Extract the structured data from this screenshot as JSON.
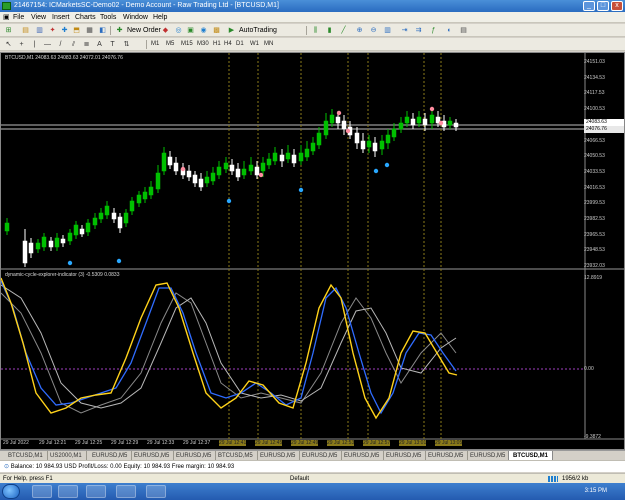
{
  "window": {
    "title": "21467154: ICMarketsSC-Demo02 - Demo Account - Raw Trading Ltd - [BTCUSD,M1]"
  },
  "menu": [
    "File",
    "View",
    "Insert",
    "Charts",
    "Tools",
    "Window",
    "Help"
  ],
  "toolbar": {
    "new_order": "New Order",
    "autotrading": "AutoTrading",
    "timeframes": [
      "M1",
      "M5",
      "M15",
      "M30",
      "H1",
      "H4",
      "D1",
      "W1",
      "MN"
    ]
  },
  "chart": {
    "info_label": "BTCUSD,M1  24083.63 24083.63 24072.01 24076.76",
    "indicator_label": "dynamic-cycle-explorer-indicator (3) -0.5309 0.0833",
    "price_axis": [
      "24151.03",
      "24134.53",
      "24117.53",
      "24100.53",
      "24083.53",
      "24066.53",
      "24050.53",
      "24033.53",
      "24016.53",
      "23999.53",
      "23982.53",
      "23965.53",
      "23948.53",
      "23932.03"
    ],
    "current_price_1": "24083.63",
    "current_price_2": "24076.76",
    "indicator_axis": [
      "12.8919",
      "0.00",
      "-9.3872"
    ],
    "time_axis": [
      "29 Jul 2022",
      "29 Jul 12:21",
      "29 Jul 12:25",
      "29 Jul 12:29",
      "29 Jul 12:33",
      "29 Jul 12:37",
      "29 Jul 12:41",
      "29 Jul 12:45",
      "29 Jul 12:49",
      "29 Jul 12:53",
      "29 Jul 12:57",
      "29 Jul 13:01",
      "29 Jul 13:05"
    ],
    "colors": {
      "background": "#000000",
      "bull": "#00c000",
      "bear": "#ffffff",
      "signal_up": "#29a8ff",
      "signal_down": "#ff8ca0",
      "fast_line": "#ffd21a",
      "slow_line": "#2f6cff",
      "vline": "#8a7a1a"
    }
  },
  "tabs": [
    "BTCUSD,M1",
    "US2000,M1",
    "EURUSD,M5",
    "EURUSD,M5",
    "EURUSD,M5",
    "BTCUSD,M5",
    "EURUSD,M5",
    "EURUSD,M5",
    "EURUSD,M5",
    "EURUSD,M5",
    "EURUSD,M5",
    "EURUSD,M5",
    "BTCUSD,M1"
  ],
  "active_tab_index": 12,
  "trade": {
    "balance_text": "Balance: 10 984.93 USD   Profit/Loss: 0.00   Equity: 10 984.93   Free margin: 10 984.93"
  },
  "status": {
    "help": "For Help, press F1",
    "profile": "Default",
    "traffic": "1956/2 kb"
  },
  "taskbar": {
    "clock": "3:15 PM"
  }
}
